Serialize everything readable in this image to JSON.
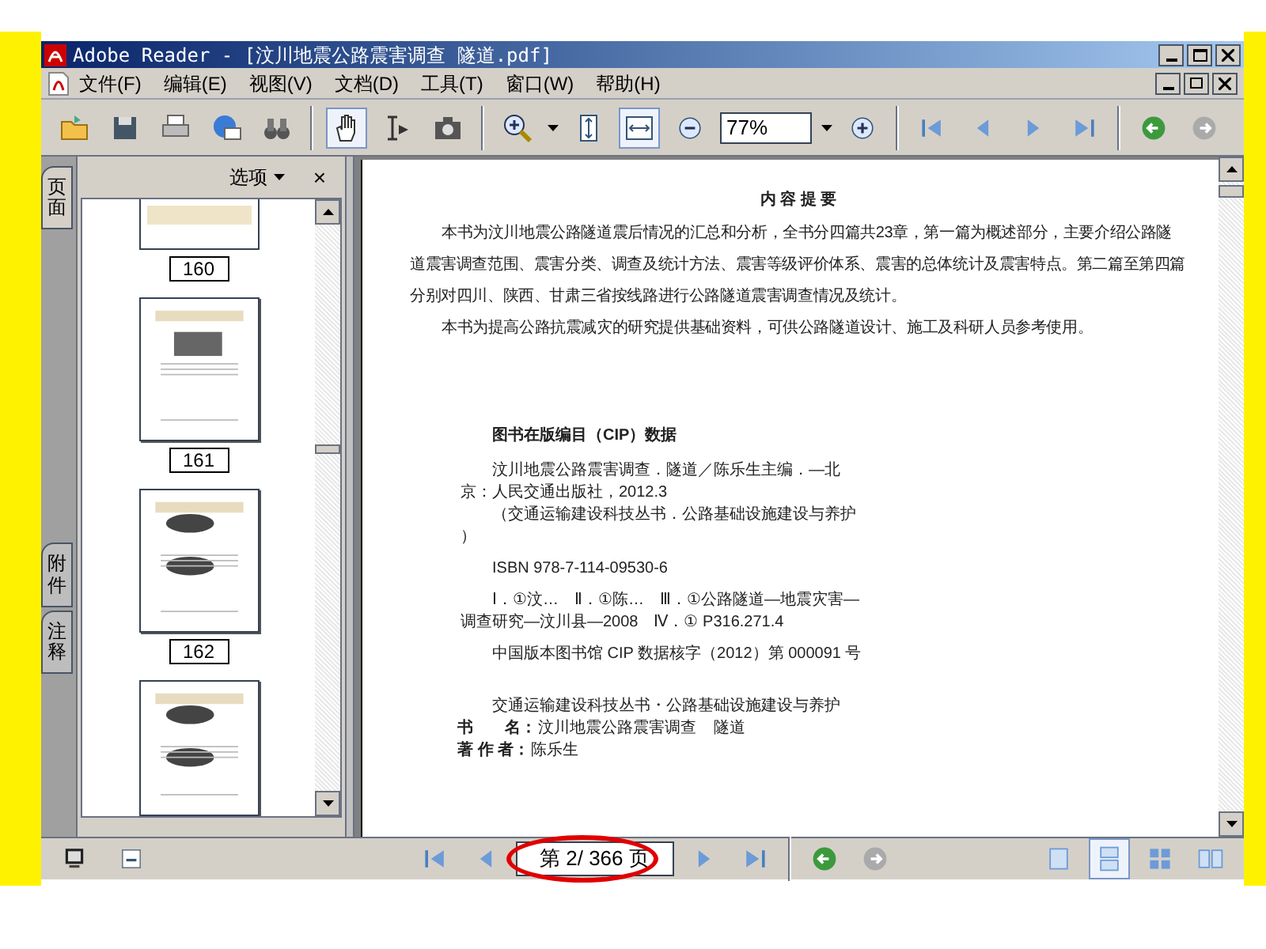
{
  "window": {
    "title": "Adobe Reader - [汶川地震公路震害调查 隧道.pdf]"
  },
  "menu": [
    "文件(F)",
    "编辑(E)",
    "视图(V)",
    "文档(D)",
    "工具(T)",
    "窗口(W)",
    "帮助(H)"
  ],
  "toolbar": {
    "tools": [
      {
        "kind": "hand",
        "selected": true
      },
      {
        "kind": "select",
        "selected": false
      },
      {
        "kind": "snapshot",
        "selected": false
      }
    ],
    "fit": [
      {
        "kind": "page",
        "selected": false
      },
      {
        "kind": "width",
        "selected": true
      }
    ],
    "zoom": "77%"
  },
  "side_tabs": [
    {
      "label": "页面",
      "selected": true
    },
    {
      "label": "附件",
      "selected": false
    },
    {
      "label": "注释",
      "selected": false
    }
  ],
  "panel": {
    "options": "选项",
    "close": "×",
    "thumbnails": [
      "160",
      "161",
      "162"
    ]
  },
  "document": {
    "heading": "内 容 提 要",
    "paragraphs": [
      "本书为汶川地震公路隧道震后情况的汇总和分析，全书分四篇共23章，第一篇为概述部分，主要介绍公路隧道震害调查范围、震害分类、调查及统计方法、震害等级评价体系、震害的总体统计及震害特点。第二篇至第四篇分别对四川、陕西、甘肃三省按线路进行公路隧道震害调查情况及统计。",
      "本书为提高公路抗震减灾的研究提供基础资料，可供公路隧道设计、施工及科研人员参考使用。"
    ],
    "cip_title": "图书在版编目（CIP）数据",
    "cip_lines": [
      {
        "kind": "indented",
        "text": "汶川地震公路震害调查．隧道／陈乐生主编．—北"
      },
      {
        "kind": "flush",
        "text": "京：人民交通出版社，2012.3"
      },
      {
        "kind": "indented",
        "text": "（交通运输建设科技丛书．公路基础设施建设与养护"
      },
      {
        "kind": "flush",
        "text": "）"
      },
      {
        "kind": "gap",
        "text": "ISBN 978-7-114-09530-6"
      },
      {
        "kind": "gap",
        "text": "Ⅰ．①汶…　Ⅱ．①陈…　Ⅲ．①公路隧道—地震灾害—"
      },
      {
        "kind": "flush",
        "text": "调查研究—汶川县—2008　Ⅳ．① P316.271.4"
      },
      {
        "kind": "gap",
        "text": "中国版本图书馆 CIP 数据核字（2012）第 000091 号"
      }
    ],
    "series": "交通运输建设科技丛书・公路基础设施建设与养护",
    "fields": [
      {
        "label": "书　　名：",
        "value": "汶川地震公路震害调查",
        "extra": "隧道"
      },
      {
        "label": "著 作 者：",
        "value": "陈乐生"
      }
    ]
  },
  "page_nav": {
    "page": "第 2/ 366 页"
  },
  "view_modes": [
    {
      "kind": "single",
      "selected": false
    },
    {
      "kind": "continuous",
      "selected": true
    },
    {
      "kind": "grid",
      "selected": false
    },
    {
      "kind": "facing",
      "selected": false
    }
  ]
}
